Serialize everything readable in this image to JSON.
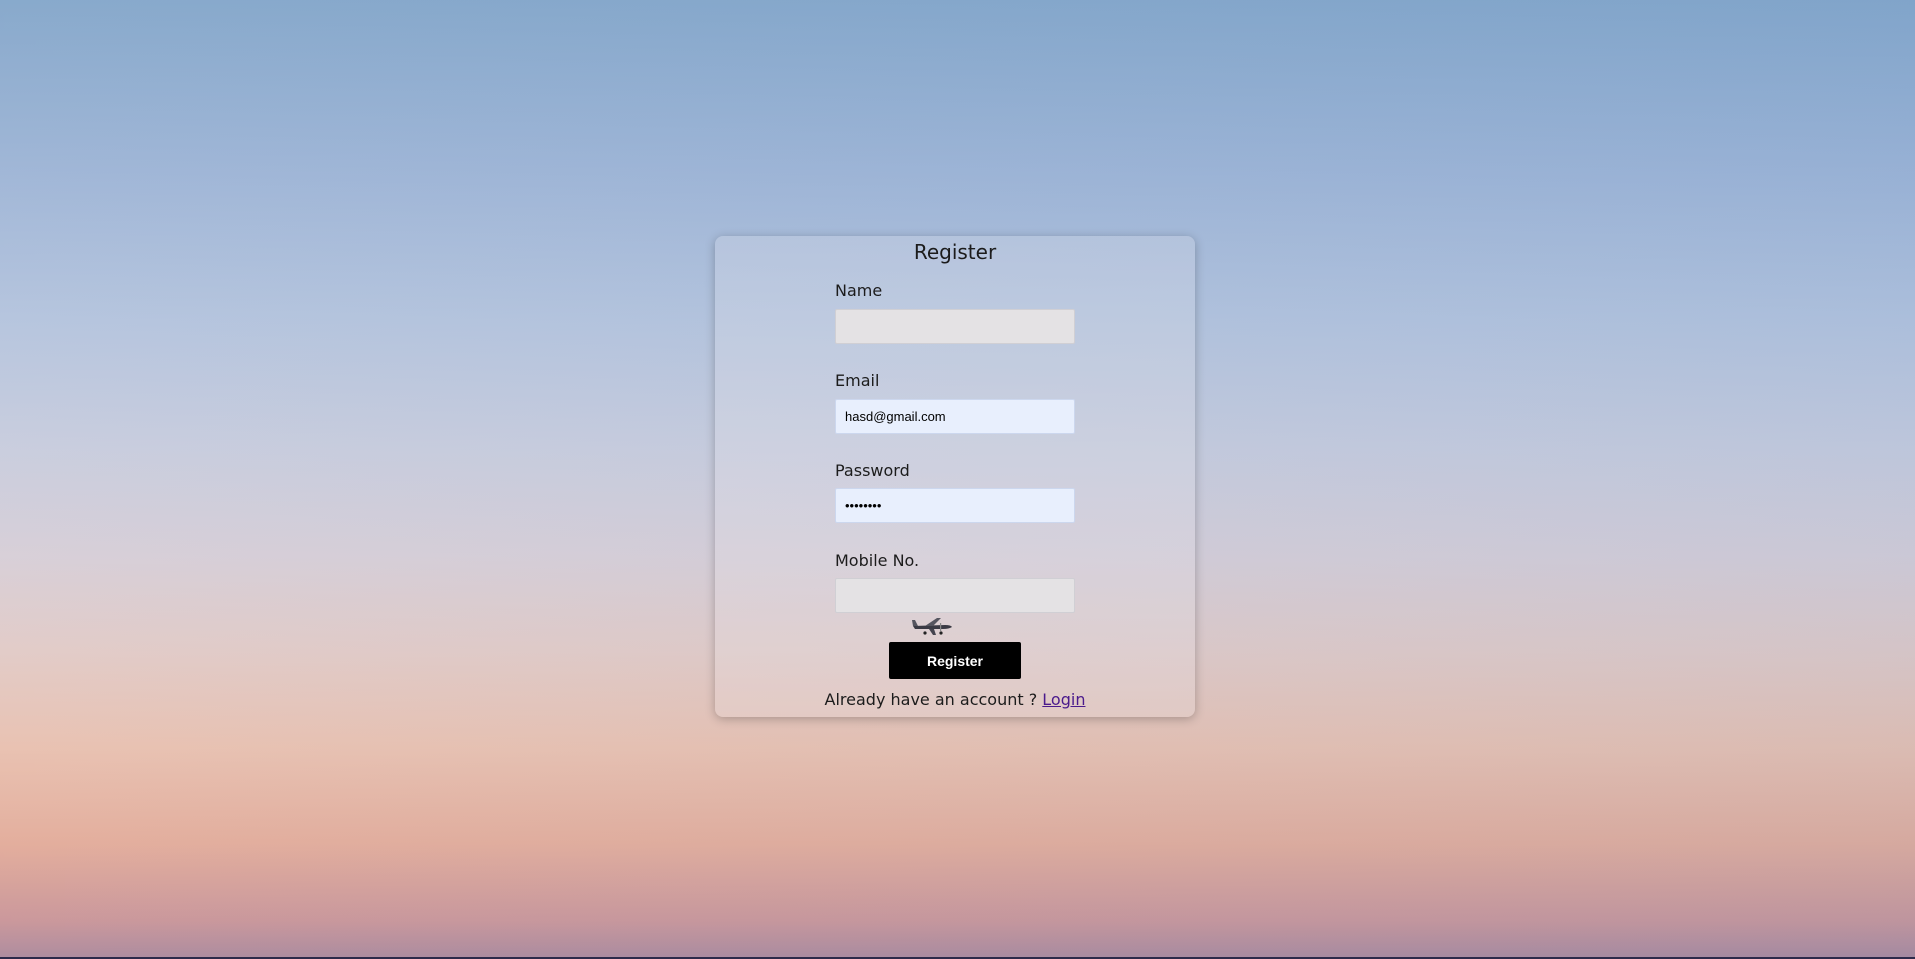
{
  "form": {
    "title": "Register",
    "fields": {
      "name": {
        "label": "Name",
        "value": "",
        "placeholder": ""
      },
      "email": {
        "label": "Email",
        "value": "hasd@gmail.com",
        "placeholder": ""
      },
      "password": {
        "label": "Password",
        "value": "........",
        "placeholder": ""
      },
      "mobile": {
        "label": "Mobile No.",
        "value": "",
        "placeholder": ""
      }
    },
    "submit_label": "Register",
    "footer_text": "Already have an account ?",
    "login_link": "Login"
  },
  "decor": {
    "plane_icon": "airplane-icon"
  },
  "colors": {
    "button_bg": "#000000",
    "button_text": "#ffffff",
    "autofill_bg": "#e8effd",
    "link": "#4a1a8c"
  }
}
